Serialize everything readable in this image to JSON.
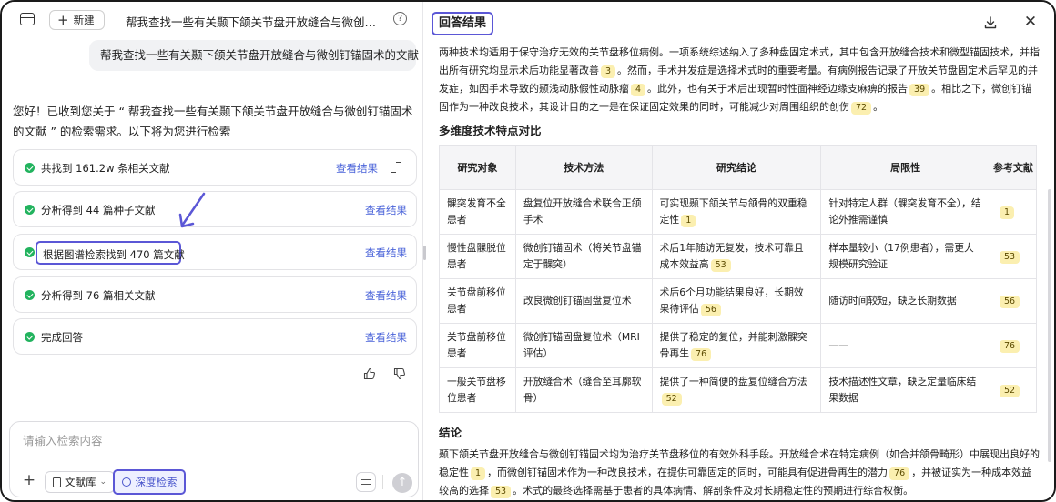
{
  "left": {
    "new_label": "新建",
    "chat_title": "帮我查找一些有关颞下颌关节盘开放缝合与微创钉锚固术的文献",
    "user_message": "帮我查找一些有关颞下颌关节盘开放缝合与微创钉锚固术的文献",
    "ai_intro": "您好！已收到您关于 “ 帮我查找一些有关颞下颌关节盘开放缝合与微创钉锚固术的文献 ” 的检索需求。以下将为您进行检索",
    "steps": [
      {
        "text": "共找到 161.2w 条相关文献",
        "action": "查看结果"
      },
      {
        "text": "分析得到 44 篇种子文献",
        "action": "查看结果"
      },
      {
        "text": "根据图谱检索找到 470 篇文献",
        "action": "查看结果"
      },
      {
        "text": "分析得到 76 篇相关文献",
        "action": "查看结果"
      },
      {
        "text": "完成回答",
        "action": "查看结果"
      }
    ],
    "input_placeholder": "请输入检索内容",
    "library_label": "文献库",
    "deep_search_label": "深度检索"
  },
  "right": {
    "title": "回答结果",
    "intro_parts": [
      "两种技术均适用于保守治疗无效的关节盘移位病例。一项系统综述纳入了多种盘固定术式，其中包含开放缝合技术和微型锚固技术，并指出所有研究均显示术后功能显著改善",
      "3",
      "。然而，手术并发症是选择术式时的重要考量。有病例报告记录了开放关节盘固定术后罕见的并发症，如因手术导致的颞浅动脉假性动脉瘤",
      "4",
      "。此外，也有关于术后出现暂时性面神经边缘支麻痹的报告",
      "39",
      "。相比之下，微创钉锚固作为一种改良技术，其设计目的之一是在保证固定效果的同时，可能减少对周围组织的创伤",
      "72",
      "。"
    ],
    "section_compare": "多维度技术特点对比",
    "table": {
      "headers": [
        "研究对象",
        "技术方法",
        "研究结论",
        "局限性",
        "参考文献"
      ],
      "rows": [
        {
          "subject": "髁突发育不全患者",
          "method": "盘复位开放缝合术联合正颌手术",
          "conclusion": "可实现颞下颌关节与颌骨的双重稳定性",
          "limitation": "针对特定人群（髁突发育不全），结论外推需谨慎",
          "ref": "1"
        },
        {
          "subject": "慢性盘髁脱位患者",
          "method": "微创钉锚固术（将关节盘锚定于髁突）",
          "conclusion": "术后1年随访无复发，技术可靠且成本效益高",
          "conclusion_ref": "53",
          "limitation": "样本量较小（17例患者），需更大规模研究验证",
          "ref": "53"
        },
        {
          "subject": "关节盘前移位患者",
          "method": "改良微创钉锚固盘复位术",
          "conclusion": "术后6个月功能结果良好，长期效果待评估",
          "conclusion_ref": "56",
          "limitation": "随访时间较短，缺乏长期数据",
          "ref": "56"
        },
        {
          "subject": "关节盘前移位患者",
          "method": "微创钉锚固盘复位术（MRI评估）",
          "conclusion": "提供了稳定的复位，并能刺激髁突骨再生",
          "conclusion_ref": "76",
          "limitation": "——",
          "ref": "76"
        },
        {
          "subject": "一般关节盘移位患者",
          "method": "开放缝合术（缝合至耳廓软骨）",
          "conclusion": "提供了一种简便的盘复位缝合方法",
          "conclusion_ref": "52",
          "limitation": "技术描述性文章，缺乏定量临床结果数据",
          "ref": "52"
        }
      ]
    },
    "section_conclusion": "结论",
    "conclusion_parts": [
      "颞下颌关节盘开放缝合与微创钉锚固术均为治疗关节盘移位的有效外科手段。开放缝合术在特定病例（如合并颌骨畸形）中展现出良好的稳定性",
      "1",
      "，而微创钉锚固术作为一种改良技术，在提供可靠固定的同时，可能具有促进骨再生的潜力",
      "76",
      "，并被证实为一种成本效益较高的选择",
      "53",
      "。术式的最终选择需基于患者的具体病情、解剖条件及对长期稳定性的预期进行综合权衡。"
    ]
  },
  "colors": {
    "accent": "#5b57d6",
    "link": "#4a63d9",
    "check": "#22b35e",
    "ref_bg": "#fbefb0"
  }
}
